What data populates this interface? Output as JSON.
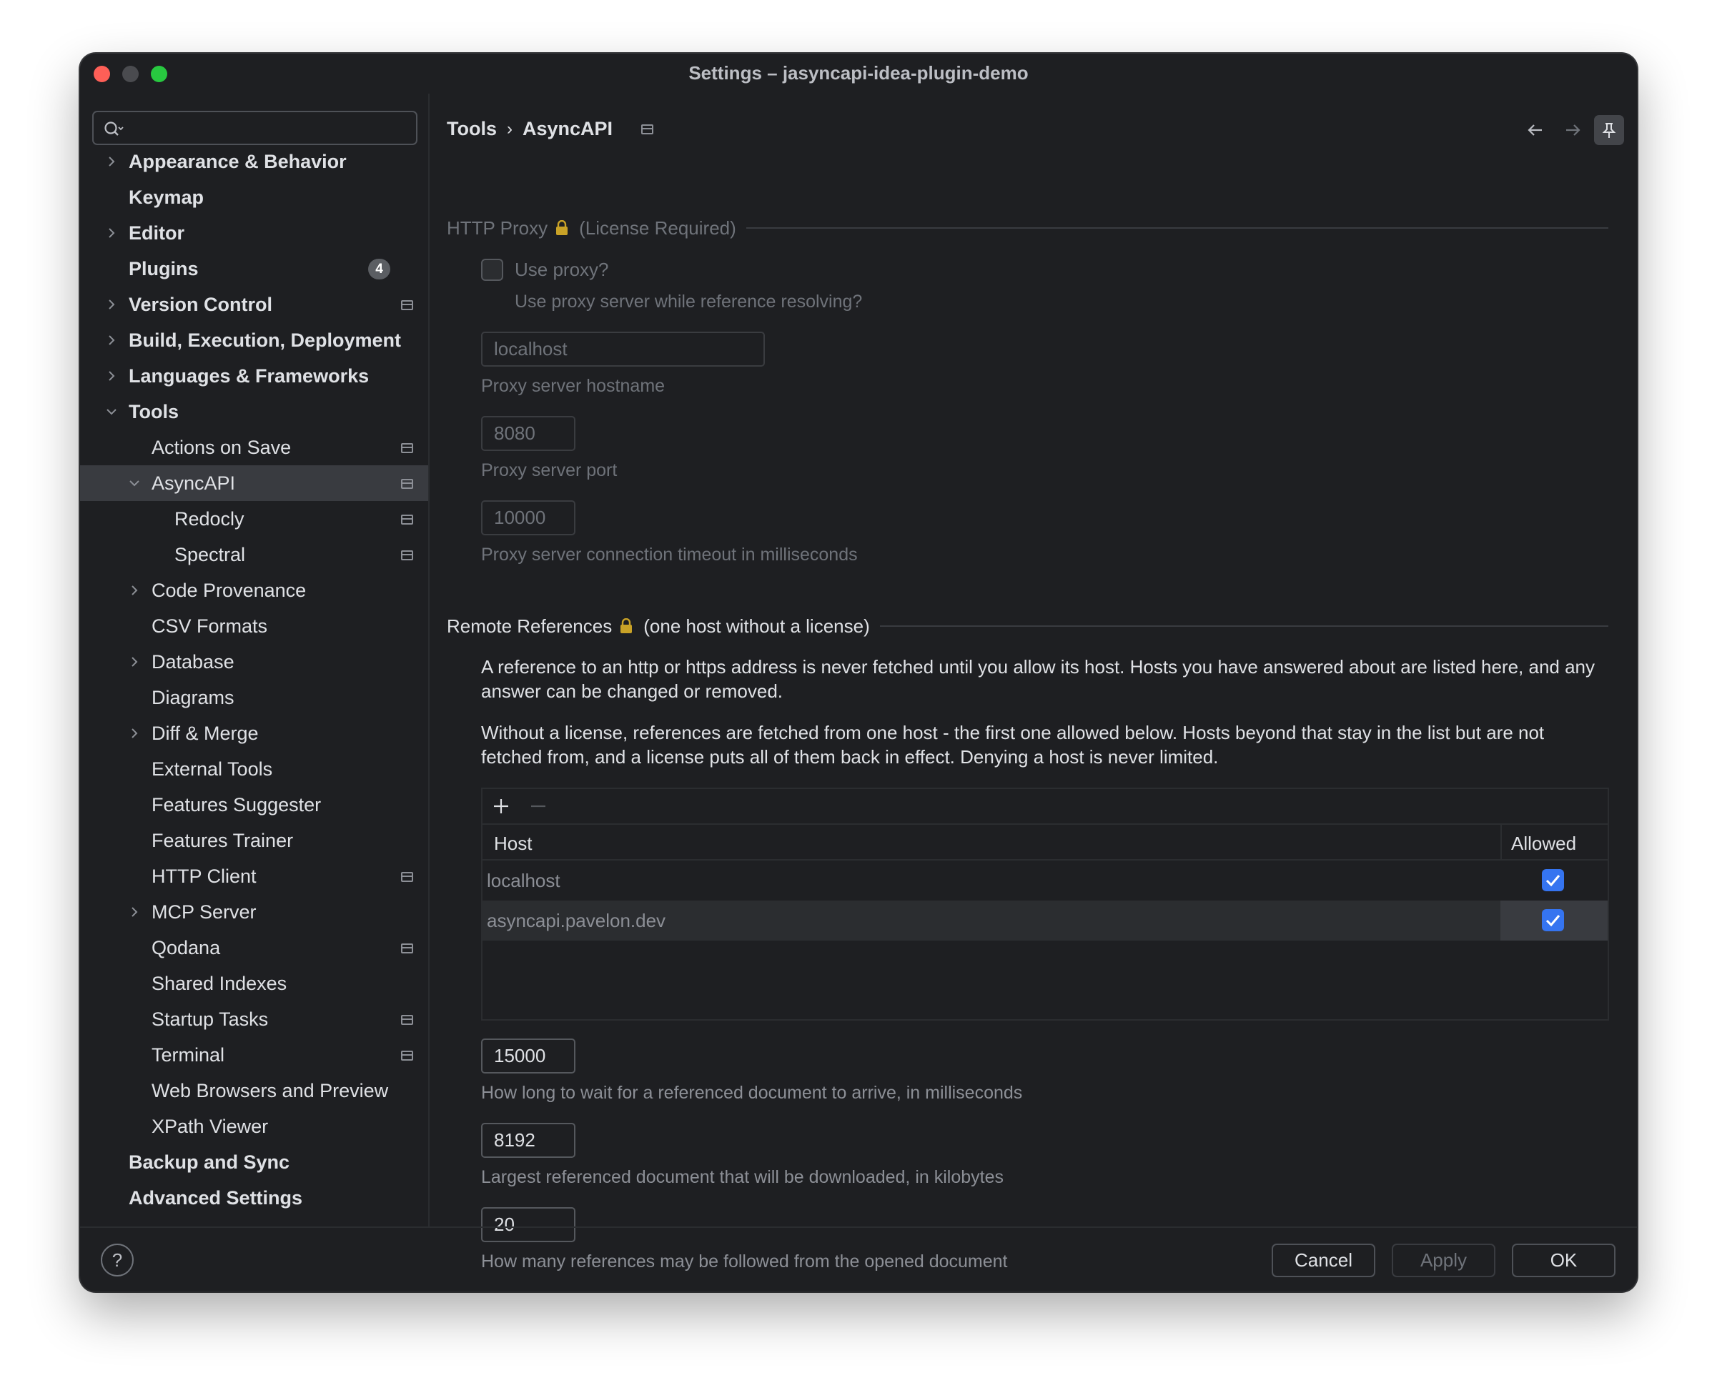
{
  "window": {
    "title": "Settings – jasyncapi-idea-plugin-demo"
  },
  "search": {
    "placeholder": ""
  },
  "sidebar": {
    "items": [
      {
        "label": "Appearance & Behavior",
        "level": 0,
        "chevron": "right"
      },
      {
        "label": "Keymap",
        "level": 0
      },
      {
        "label": "Editor",
        "level": 0,
        "chevron": "right"
      },
      {
        "label": "Plugins",
        "level": 0,
        "badge": "4"
      },
      {
        "label": "Version Control",
        "level": 0,
        "chevron": "right",
        "project_icon": true
      },
      {
        "label": "Build, Execution, Deployment",
        "level": 0,
        "chevron": "right"
      },
      {
        "label": "Languages & Frameworks",
        "level": 0,
        "chevron": "right"
      },
      {
        "label": "Tools",
        "level": 0,
        "chevron": "down"
      },
      {
        "label": "Actions on Save",
        "level": 1,
        "project_icon": true
      },
      {
        "label": "AsyncAPI",
        "level": 1,
        "chevron": "down",
        "project_icon": true,
        "selected": true
      },
      {
        "label": "Redocly",
        "level": 2,
        "project_icon": true
      },
      {
        "label": "Spectral",
        "level": 2,
        "project_icon": true
      },
      {
        "label": "Code Provenance",
        "level": 1,
        "chevron": "right"
      },
      {
        "label": "CSV Formats",
        "level": 1
      },
      {
        "label": "Database",
        "level": 1,
        "chevron": "right"
      },
      {
        "label": "Diagrams",
        "level": 1
      },
      {
        "label": "Diff & Merge",
        "level": 1,
        "chevron": "right"
      },
      {
        "label": "External Tools",
        "level": 1
      },
      {
        "label": "Features Suggester",
        "level": 1
      },
      {
        "label": "Features Trainer",
        "level": 1
      },
      {
        "label": "HTTP Client",
        "level": 1,
        "project_icon": true
      },
      {
        "label": "MCP Server",
        "level": 1,
        "chevron": "right"
      },
      {
        "label": "Qodana",
        "level": 1,
        "project_icon": true
      },
      {
        "label": "Shared Indexes",
        "level": 1
      },
      {
        "label": "Startup Tasks",
        "level": 1,
        "project_icon": true
      },
      {
        "label": "Terminal",
        "level": 1,
        "project_icon": true
      },
      {
        "label": "Web Browsers and Preview",
        "level": 1
      },
      {
        "label": "XPath Viewer",
        "level": 1
      },
      {
        "label": "Backup and Sync",
        "level": 0
      },
      {
        "label": "Advanced Settings",
        "level": 0
      }
    ]
  },
  "breadcrumb": {
    "parent": "Tools",
    "separator": "›",
    "current": "AsyncAPI"
  },
  "http_proxy": {
    "group_title": "HTTP Proxy",
    "license_note": "(License Required)",
    "use_proxy_label": "Use proxy?",
    "use_proxy_checked": false,
    "use_proxy_hint": "Use proxy server while reference resolving?",
    "hostname_value": "localhost",
    "hostname_hint": "Proxy server hostname",
    "port_value": "8080",
    "port_hint": "Proxy server port",
    "timeout_value": "10000",
    "timeout_hint": "Proxy server connection timeout in milliseconds"
  },
  "remote_refs": {
    "group_title": "Remote References",
    "license_note": "(one host without a license)",
    "paragraph1": "A reference to an http or https address is never fetched until you allow its host. Hosts you have answered about are listed here, and any answer can be changed or removed.",
    "paragraph2": "Without a license, references are fetched from one host - the first one allowed below. Hosts beyond that stay in the list but are not fetched from, and a license puts all of them back in effect. Denying a host is never limited.",
    "table": {
      "col_host": "Host",
      "col_allowed": "Allowed",
      "rows": [
        {
          "host": "localhost",
          "allowed": true
        },
        {
          "host": "asyncapi.pavelon.dev",
          "allowed": true
        }
      ]
    },
    "wait_value": "15000",
    "wait_hint": "How long to wait for a referenced document to arrive, in milliseconds",
    "size_value": "8192",
    "size_hint": "Largest referenced document that will be downloaded, in kilobytes",
    "follow_value": "20",
    "follow_hint": "How many references may be followed from the opened document"
  },
  "footer": {
    "help": "?",
    "cancel": "Cancel",
    "apply": "Apply",
    "ok": "OK"
  },
  "colors": {
    "accent": "#3574f0",
    "background": "#1e1f22",
    "selection": "#393b40"
  }
}
